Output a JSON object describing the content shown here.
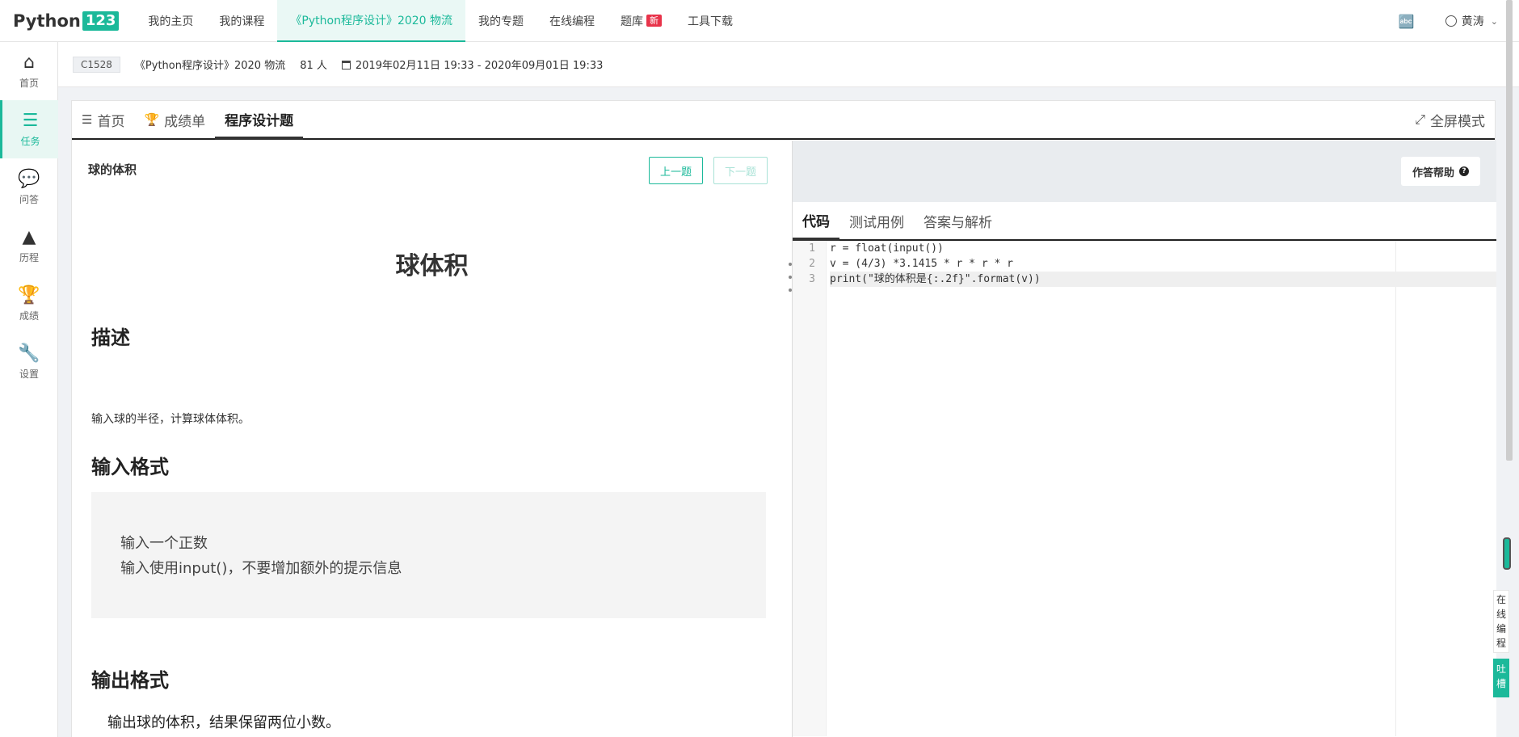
{
  "nav": {
    "logo_text": "Python",
    "logo_num": "123",
    "items": [
      {
        "label": "我的主页"
      },
      {
        "label": "我的课程"
      },
      {
        "label": "《Python程序设计》2020 物流"
      },
      {
        "label": "我的专题"
      },
      {
        "label": "在线编程"
      },
      {
        "label": "题库"
      },
      {
        "label": "工具下载"
      }
    ],
    "new_badge": "新",
    "user_name": "黄涛"
  },
  "sidebar": {
    "items": [
      {
        "label": "首页"
      },
      {
        "label": "任务"
      },
      {
        "label": "问答"
      },
      {
        "label": "历程"
      },
      {
        "label": "成绩"
      },
      {
        "label": "设置"
      }
    ]
  },
  "course": {
    "code": "C1528",
    "name": "《Python程序设计》2020 物流",
    "students": "81 人",
    "period": "2019年02月11日 19:33 - 2020年09月01日 19:33"
  },
  "tabs": [
    {
      "label": "首页"
    },
    {
      "label": "成绩单"
    },
    {
      "label": "程序设计题"
    }
  ],
  "fullscreen_label": "全屏模式",
  "problem": {
    "title": "球的体积",
    "prev_label": "上一题",
    "next_label": "下一题",
    "heading": "球体积",
    "desc_heading": "描述",
    "desc_text": "输入球的半径，计算球体体积。",
    "input_heading": "输入格式",
    "input_lines": [
      "输入一个正数",
      "输入使用input()，不要增加额外的提示信息"
    ],
    "output_heading": "输出格式",
    "output_text": "输出球的体积，结果保留两位小数。"
  },
  "editor": {
    "help_label": "作答帮助",
    "tabs": [
      {
        "label": "代码"
      },
      {
        "label": "测试用例"
      },
      {
        "label": "答案与解析"
      }
    ],
    "line_numbers": [
      "1",
      "2",
      "3"
    ],
    "code_lines": [
      "r = float(input())",
      "v = (4/3) *3.1415 * r * r * r",
      "print(\"球的体积是{:.2f}\".format(v))"
    ]
  },
  "float_widgets": {
    "online_label": "在线编程",
    "feedback_label": "吐槽"
  }
}
